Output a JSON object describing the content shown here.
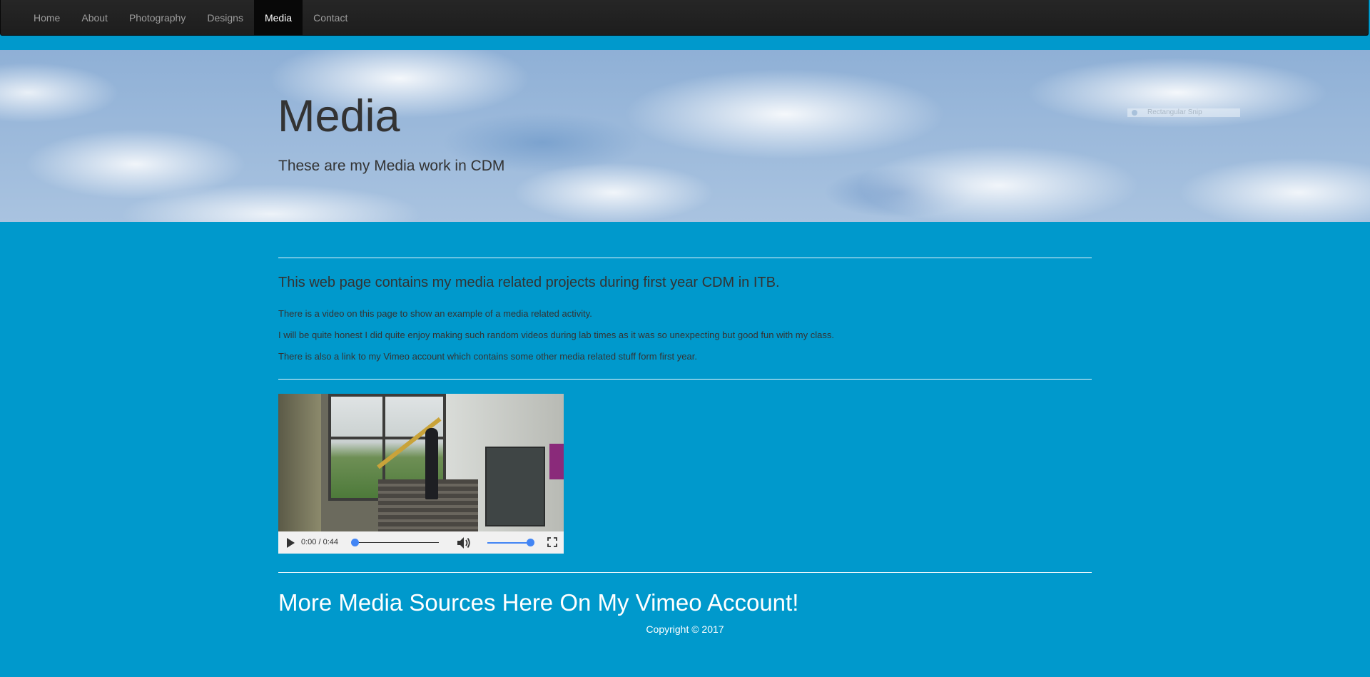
{
  "nav": {
    "items": [
      {
        "label": "Home",
        "active": false
      },
      {
        "label": "About",
        "active": false
      },
      {
        "label": "Photography",
        "active": false
      },
      {
        "label": "Designs",
        "active": false
      },
      {
        "label": "Media",
        "active": true
      },
      {
        "label": "Contact",
        "active": false
      }
    ]
  },
  "hero": {
    "title": "Media",
    "subtitle": "These are my Media work in CDM",
    "snip_overlay": "Rectangular Snip"
  },
  "intro": {
    "heading": "This web page contains my media related projects during first year CDM in ITB.",
    "paragraphs": [
      "There is a video on this page to show an example of a media related activity.",
      "I will be quite honest I did quite enjoy making such random videos during lab times as it was so unexpecting but good fun with my class.",
      "There is also a link to my Vimeo account which contains some other media related stuff form first year."
    ]
  },
  "video": {
    "time": "0:00 / 0:44",
    "progress": 0,
    "volume": 1.0
  },
  "vimeo_link": "More Media Sources Here On My Vimeo Account!",
  "footer": {
    "copyright": "Copyright © 2017"
  },
  "colors": {
    "page_bg": "#0099cc",
    "navbar_bg": "#222222",
    "nav_active_bg": "#080808",
    "text_dark": "#333333",
    "accent_blue": "#4285f4"
  }
}
